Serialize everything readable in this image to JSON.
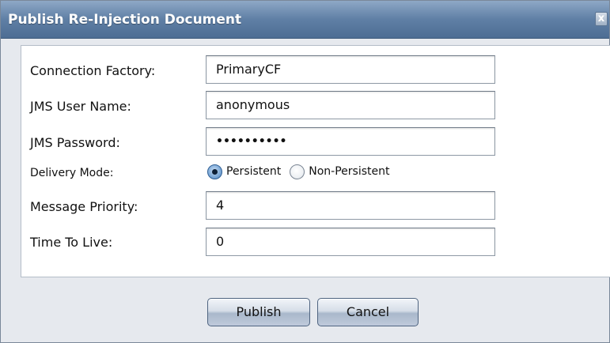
{
  "dialog": {
    "title": "Publish Re-Injection Document",
    "close_glyph": "x"
  },
  "form": {
    "connection_factory": {
      "label": "Connection Factory:",
      "value": "PrimaryCF"
    },
    "jms_user_name": {
      "label": "JMS User Name:",
      "value": "anonymous"
    },
    "jms_password": {
      "label": "JMS Password:",
      "value": "••••••••••"
    },
    "delivery_mode": {
      "label": "Delivery Mode:",
      "options": [
        "Persistent",
        "Non-Persistent"
      ],
      "selected": "Persistent"
    },
    "message_priority": {
      "label": "Message Priority:",
      "value": "4"
    },
    "time_to_live": {
      "label": "Time To Live:",
      "value": "0"
    }
  },
  "buttons": {
    "publish_label": "Publish",
    "cancel_label": "Cancel"
  },
  "colors": {
    "title_bar": "#5f7fa5",
    "panel_bg": "#ffffff",
    "dialog_bg": "#e6e9ee",
    "radio_selected": "#4f80ba"
  }
}
